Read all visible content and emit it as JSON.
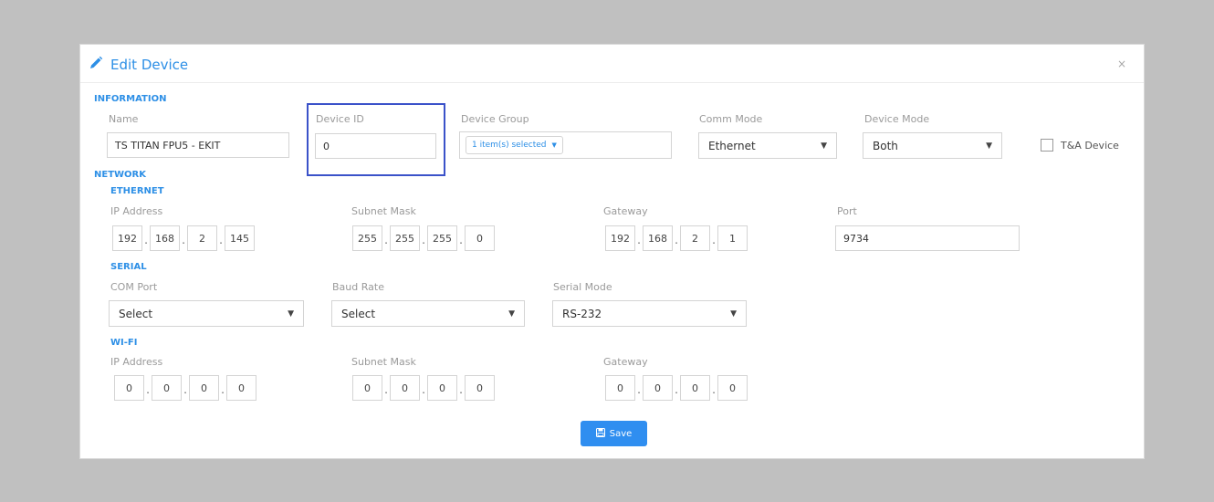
{
  "modal": {
    "title": "Edit Device",
    "close_glyph": "×",
    "save_label": "Save"
  },
  "sections": {
    "information": "INFORMATION",
    "network": "NETWORK",
    "ethernet": "ETHERNET",
    "serial": "SERIAL",
    "wifi": "WI-FI"
  },
  "information": {
    "name": {
      "label": "Name",
      "value": "TS TITAN FPU5 - EKIT"
    },
    "device_id": {
      "label": "Device ID",
      "value": "0"
    },
    "device_group": {
      "label": "Device Group",
      "value": "1 item(s) selected"
    },
    "comm_mode": {
      "label": "Comm Mode",
      "value": "Ethernet"
    },
    "device_mode": {
      "label": "Device Mode",
      "value": "Both"
    },
    "ta_device": {
      "label": "T&A Device",
      "checked": false
    }
  },
  "ethernet": {
    "ip_label": "IP Address",
    "ip": [
      "192",
      "168",
      "2",
      "145"
    ],
    "subnet_label": "Subnet Mask",
    "subnet": [
      "255",
      "255",
      "255",
      "0"
    ],
    "gateway_label": "Gateway",
    "gateway": [
      "192",
      "168",
      "2",
      "1"
    ],
    "port_label": "Port",
    "port": "9734"
  },
  "serial": {
    "com_port": {
      "label": "COM Port",
      "value": "Select"
    },
    "baud_rate": {
      "label": "Baud Rate",
      "value": "Select"
    },
    "serial_mode": {
      "label": "Serial Mode",
      "value": "RS-232"
    }
  },
  "wifi": {
    "ip_label": "IP Address",
    "ip": [
      "0",
      "0",
      "0",
      "0"
    ],
    "subnet_label": "Subnet Mask",
    "subnet": [
      "0",
      "0",
      "0",
      "0"
    ],
    "gateway_label": "Gateway",
    "gateway": [
      "0",
      "0",
      "0",
      "0"
    ]
  },
  "icons": {
    "title": "pencil-icon",
    "save": "floppy-disk-icon",
    "dropdown": "caret-down-icon"
  },
  "colors": {
    "accent": "#2d8fe6",
    "highlight": "#3b52c9",
    "save_button": "#2f8ef0",
    "backdrop": "#c0c0c0"
  }
}
